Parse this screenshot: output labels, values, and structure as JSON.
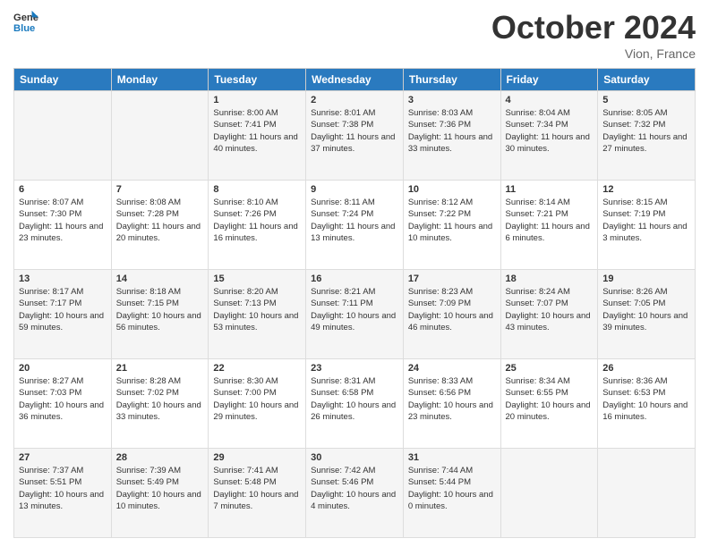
{
  "header": {
    "logo_line1": "General",
    "logo_line2": "Blue",
    "month_title": "October 2024",
    "location": "Vion, France"
  },
  "weekdays": [
    "Sunday",
    "Monday",
    "Tuesday",
    "Wednesday",
    "Thursday",
    "Friday",
    "Saturday"
  ],
  "weeks": [
    [
      {
        "day": "",
        "sunrise": "",
        "sunset": "",
        "daylight": ""
      },
      {
        "day": "",
        "sunrise": "",
        "sunset": "",
        "daylight": ""
      },
      {
        "day": "1",
        "sunrise": "Sunrise: 8:00 AM",
        "sunset": "Sunset: 7:41 PM",
        "daylight": "Daylight: 11 hours and 40 minutes."
      },
      {
        "day": "2",
        "sunrise": "Sunrise: 8:01 AM",
        "sunset": "Sunset: 7:38 PM",
        "daylight": "Daylight: 11 hours and 37 minutes."
      },
      {
        "day": "3",
        "sunrise": "Sunrise: 8:03 AM",
        "sunset": "Sunset: 7:36 PM",
        "daylight": "Daylight: 11 hours and 33 minutes."
      },
      {
        "day": "4",
        "sunrise": "Sunrise: 8:04 AM",
        "sunset": "Sunset: 7:34 PM",
        "daylight": "Daylight: 11 hours and 30 minutes."
      },
      {
        "day": "5",
        "sunrise": "Sunrise: 8:05 AM",
        "sunset": "Sunset: 7:32 PM",
        "daylight": "Daylight: 11 hours and 27 minutes."
      }
    ],
    [
      {
        "day": "6",
        "sunrise": "Sunrise: 8:07 AM",
        "sunset": "Sunset: 7:30 PM",
        "daylight": "Daylight: 11 hours and 23 minutes."
      },
      {
        "day": "7",
        "sunrise": "Sunrise: 8:08 AM",
        "sunset": "Sunset: 7:28 PM",
        "daylight": "Daylight: 11 hours and 20 minutes."
      },
      {
        "day": "8",
        "sunrise": "Sunrise: 8:10 AM",
        "sunset": "Sunset: 7:26 PM",
        "daylight": "Daylight: 11 hours and 16 minutes."
      },
      {
        "day": "9",
        "sunrise": "Sunrise: 8:11 AM",
        "sunset": "Sunset: 7:24 PM",
        "daylight": "Daylight: 11 hours and 13 minutes."
      },
      {
        "day": "10",
        "sunrise": "Sunrise: 8:12 AM",
        "sunset": "Sunset: 7:22 PM",
        "daylight": "Daylight: 11 hours and 10 minutes."
      },
      {
        "day": "11",
        "sunrise": "Sunrise: 8:14 AM",
        "sunset": "Sunset: 7:21 PM",
        "daylight": "Daylight: 11 hours and 6 minutes."
      },
      {
        "day": "12",
        "sunrise": "Sunrise: 8:15 AM",
        "sunset": "Sunset: 7:19 PM",
        "daylight": "Daylight: 11 hours and 3 minutes."
      }
    ],
    [
      {
        "day": "13",
        "sunrise": "Sunrise: 8:17 AM",
        "sunset": "Sunset: 7:17 PM",
        "daylight": "Daylight: 10 hours and 59 minutes."
      },
      {
        "day": "14",
        "sunrise": "Sunrise: 8:18 AM",
        "sunset": "Sunset: 7:15 PM",
        "daylight": "Daylight: 10 hours and 56 minutes."
      },
      {
        "day": "15",
        "sunrise": "Sunrise: 8:20 AM",
        "sunset": "Sunset: 7:13 PM",
        "daylight": "Daylight: 10 hours and 53 minutes."
      },
      {
        "day": "16",
        "sunrise": "Sunrise: 8:21 AM",
        "sunset": "Sunset: 7:11 PM",
        "daylight": "Daylight: 10 hours and 49 minutes."
      },
      {
        "day": "17",
        "sunrise": "Sunrise: 8:23 AM",
        "sunset": "Sunset: 7:09 PM",
        "daylight": "Daylight: 10 hours and 46 minutes."
      },
      {
        "day": "18",
        "sunrise": "Sunrise: 8:24 AM",
        "sunset": "Sunset: 7:07 PM",
        "daylight": "Daylight: 10 hours and 43 minutes."
      },
      {
        "day": "19",
        "sunrise": "Sunrise: 8:26 AM",
        "sunset": "Sunset: 7:05 PM",
        "daylight": "Daylight: 10 hours and 39 minutes."
      }
    ],
    [
      {
        "day": "20",
        "sunrise": "Sunrise: 8:27 AM",
        "sunset": "Sunset: 7:03 PM",
        "daylight": "Daylight: 10 hours and 36 minutes."
      },
      {
        "day": "21",
        "sunrise": "Sunrise: 8:28 AM",
        "sunset": "Sunset: 7:02 PM",
        "daylight": "Daylight: 10 hours and 33 minutes."
      },
      {
        "day": "22",
        "sunrise": "Sunrise: 8:30 AM",
        "sunset": "Sunset: 7:00 PM",
        "daylight": "Daylight: 10 hours and 29 minutes."
      },
      {
        "day": "23",
        "sunrise": "Sunrise: 8:31 AM",
        "sunset": "Sunset: 6:58 PM",
        "daylight": "Daylight: 10 hours and 26 minutes."
      },
      {
        "day": "24",
        "sunrise": "Sunrise: 8:33 AM",
        "sunset": "Sunset: 6:56 PM",
        "daylight": "Daylight: 10 hours and 23 minutes."
      },
      {
        "day": "25",
        "sunrise": "Sunrise: 8:34 AM",
        "sunset": "Sunset: 6:55 PM",
        "daylight": "Daylight: 10 hours and 20 minutes."
      },
      {
        "day": "26",
        "sunrise": "Sunrise: 8:36 AM",
        "sunset": "Sunset: 6:53 PM",
        "daylight": "Daylight: 10 hours and 16 minutes."
      }
    ],
    [
      {
        "day": "27",
        "sunrise": "Sunrise: 7:37 AM",
        "sunset": "Sunset: 5:51 PM",
        "daylight": "Daylight: 10 hours and 13 minutes."
      },
      {
        "day": "28",
        "sunrise": "Sunrise: 7:39 AM",
        "sunset": "Sunset: 5:49 PM",
        "daylight": "Daylight: 10 hours and 10 minutes."
      },
      {
        "day": "29",
        "sunrise": "Sunrise: 7:41 AM",
        "sunset": "Sunset: 5:48 PM",
        "daylight": "Daylight: 10 hours and 7 minutes."
      },
      {
        "day": "30",
        "sunrise": "Sunrise: 7:42 AM",
        "sunset": "Sunset: 5:46 PM",
        "daylight": "Daylight: 10 hours and 4 minutes."
      },
      {
        "day": "31",
        "sunrise": "Sunrise: 7:44 AM",
        "sunset": "Sunset: 5:44 PM",
        "daylight": "Daylight: 10 hours and 0 minutes."
      },
      {
        "day": "",
        "sunrise": "",
        "sunset": "",
        "daylight": ""
      },
      {
        "day": "",
        "sunrise": "",
        "sunset": "",
        "daylight": ""
      }
    ]
  ]
}
